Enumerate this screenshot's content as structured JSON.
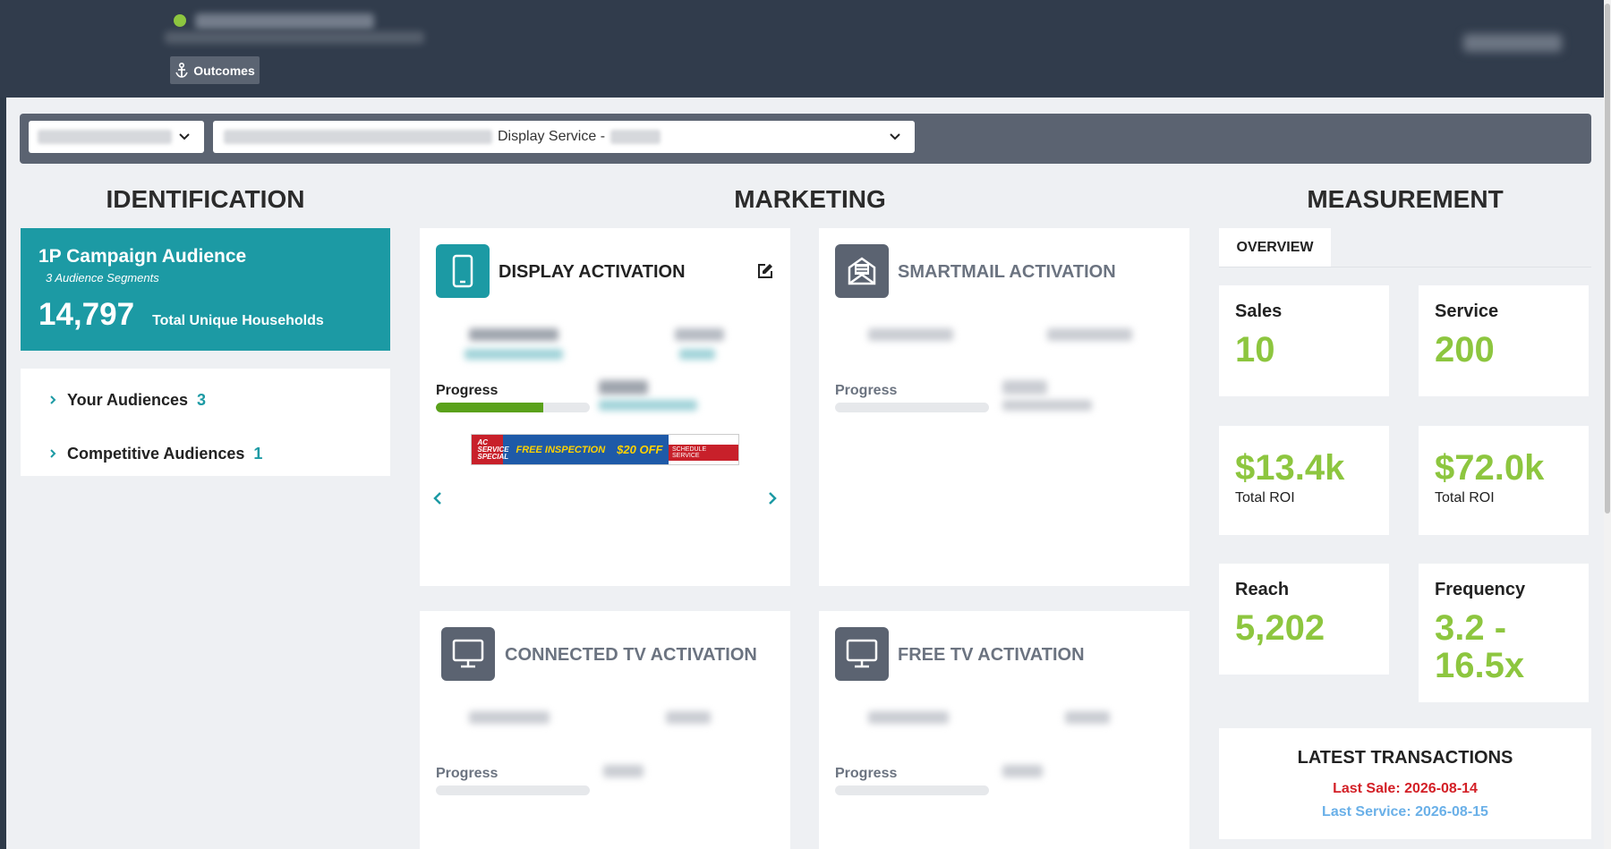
{
  "header": {
    "outcomes_label": "Outcomes",
    "status_color": "#8dc63f"
  },
  "filters": {
    "campaign_select_text": "Display Service -"
  },
  "identification": {
    "title": "IDENTIFICATION",
    "audience_card": {
      "title": "1P Campaign Audience",
      "segments": "3 Audience Segments",
      "count": "14,797",
      "count_label": "Total Unique Households"
    },
    "list": [
      {
        "label": "Your Audiences",
        "count": "3"
      },
      {
        "label": "Competitive Audiences",
        "count": "1"
      }
    ]
  },
  "marketing": {
    "title": "MARKETING",
    "cards": [
      {
        "title": "DISPLAY ACTIVATION",
        "progress_label": "Progress",
        "progress": 0.7,
        "icon": "phone-icon"
      },
      {
        "title": "SMARTMAIL ACTIVATION",
        "progress_label": "Progress",
        "progress": 0,
        "icon": "mail-icon"
      },
      {
        "title": "CONNECTED TV ACTIVATION",
        "progress_label": "Progress",
        "progress": 0,
        "icon": "monitor-icon"
      },
      {
        "title": "FREE TV ACTIVATION",
        "progress_label": "Progress",
        "progress": 0,
        "icon": "monitor-icon"
      }
    ],
    "banner": {
      "left_text": "AC SERVICE SPECIAL",
      "mid_text": "FREE INSPECTION",
      "offer_text": "$20 OFF",
      "cta_text": "SCHEDULE SERVICE"
    }
  },
  "measurement": {
    "title": "MEASUREMENT",
    "tab_label": "OVERVIEW",
    "kpis": {
      "sales": {
        "label": "Sales",
        "value": "10"
      },
      "service": {
        "label": "Service",
        "value": "200"
      },
      "roi_sales": {
        "value": "$13.4k",
        "sub": "Total ROI"
      },
      "roi_service": {
        "value": "$72.0k",
        "sub": "Total ROI"
      },
      "reach": {
        "label": "Reach",
        "value": "5,202"
      },
      "frequency": {
        "label": "Frequency",
        "value": "3.2 - 16.5x"
      }
    },
    "latest": {
      "title": "LATEST TRANSACTIONS",
      "sale": "Last Sale: 2026-08-14",
      "service": "Last Service: 2026-08-15"
    }
  },
  "colors": {
    "teal": "#1c9aa4",
    "green": "#8dc63f",
    "sale_red": "#d32027",
    "service_blue": "#6ab0e8",
    "header_bg": "#313c4c"
  }
}
